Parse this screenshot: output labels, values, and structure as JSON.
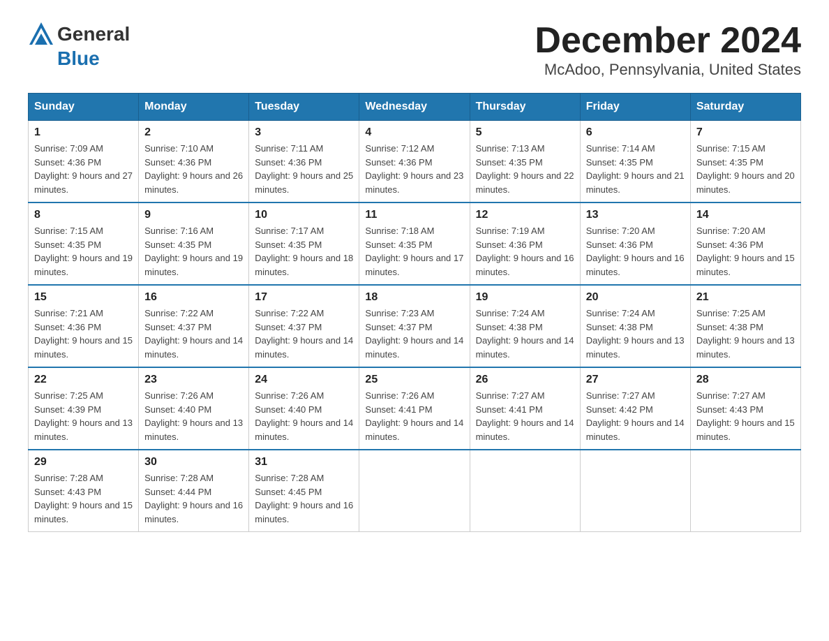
{
  "header": {
    "logo_general": "General",
    "logo_blue": "Blue",
    "title": "December 2024",
    "subtitle": "McAdoo, Pennsylvania, United States"
  },
  "calendar": {
    "days_of_week": [
      "Sunday",
      "Monday",
      "Tuesday",
      "Wednesday",
      "Thursday",
      "Friday",
      "Saturday"
    ],
    "weeks": [
      [
        {
          "day": "1",
          "sunrise": "7:09 AM",
          "sunset": "4:36 PM",
          "daylight": "9 hours and 27 minutes."
        },
        {
          "day": "2",
          "sunrise": "7:10 AM",
          "sunset": "4:36 PM",
          "daylight": "9 hours and 26 minutes."
        },
        {
          "day": "3",
          "sunrise": "7:11 AM",
          "sunset": "4:36 PM",
          "daylight": "9 hours and 25 minutes."
        },
        {
          "day": "4",
          "sunrise": "7:12 AM",
          "sunset": "4:36 PM",
          "daylight": "9 hours and 23 minutes."
        },
        {
          "day": "5",
          "sunrise": "7:13 AM",
          "sunset": "4:35 PM",
          "daylight": "9 hours and 22 minutes."
        },
        {
          "day": "6",
          "sunrise": "7:14 AM",
          "sunset": "4:35 PM",
          "daylight": "9 hours and 21 minutes."
        },
        {
          "day": "7",
          "sunrise": "7:15 AM",
          "sunset": "4:35 PM",
          "daylight": "9 hours and 20 minutes."
        }
      ],
      [
        {
          "day": "8",
          "sunrise": "7:15 AM",
          "sunset": "4:35 PM",
          "daylight": "9 hours and 19 minutes."
        },
        {
          "day": "9",
          "sunrise": "7:16 AM",
          "sunset": "4:35 PM",
          "daylight": "9 hours and 19 minutes."
        },
        {
          "day": "10",
          "sunrise": "7:17 AM",
          "sunset": "4:35 PM",
          "daylight": "9 hours and 18 minutes."
        },
        {
          "day": "11",
          "sunrise": "7:18 AM",
          "sunset": "4:35 PM",
          "daylight": "9 hours and 17 minutes."
        },
        {
          "day": "12",
          "sunrise": "7:19 AM",
          "sunset": "4:36 PM",
          "daylight": "9 hours and 16 minutes."
        },
        {
          "day": "13",
          "sunrise": "7:20 AM",
          "sunset": "4:36 PM",
          "daylight": "9 hours and 16 minutes."
        },
        {
          "day": "14",
          "sunrise": "7:20 AM",
          "sunset": "4:36 PM",
          "daylight": "9 hours and 15 minutes."
        }
      ],
      [
        {
          "day": "15",
          "sunrise": "7:21 AM",
          "sunset": "4:36 PM",
          "daylight": "9 hours and 15 minutes."
        },
        {
          "day": "16",
          "sunrise": "7:22 AM",
          "sunset": "4:37 PM",
          "daylight": "9 hours and 14 minutes."
        },
        {
          "day": "17",
          "sunrise": "7:22 AM",
          "sunset": "4:37 PM",
          "daylight": "9 hours and 14 minutes."
        },
        {
          "day": "18",
          "sunrise": "7:23 AM",
          "sunset": "4:37 PM",
          "daylight": "9 hours and 14 minutes."
        },
        {
          "day": "19",
          "sunrise": "7:24 AM",
          "sunset": "4:38 PM",
          "daylight": "9 hours and 14 minutes."
        },
        {
          "day": "20",
          "sunrise": "7:24 AM",
          "sunset": "4:38 PM",
          "daylight": "9 hours and 13 minutes."
        },
        {
          "day": "21",
          "sunrise": "7:25 AM",
          "sunset": "4:38 PM",
          "daylight": "9 hours and 13 minutes."
        }
      ],
      [
        {
          "day": "22",
          "sunrise": "7:25 AM",
          "sunset": "4:39 PM",
          "daylight": "9 hours and 13 minutes."
        },
        {
          "day": "23",
          "sunrise": "7:26 AM",
          "sunset": "4:40 PM",
          "daylight": "9 hours and 13 minutes."
        },
        {
          "day": "24",
          "sunrise": "7:26 AM",
          "sunset": "4:40 PM",
          "daylight": "9 hours and 14 minutes."
        },
        {
          "day": "25",
          "sunrise": "7:26 AM",
          "sunset": "4:41 PM",
          "daylight": "9 hours and 14 minutes."
        },
        {
          "day": "26",
          "sunrise": "7:27 AM",
          "sunset": "4:41 PM",
          "daylight": "9 hours and 14 minutes."
        },
        {
          "day": "27",
          "sunrise": "7:27 AM",
          "sunset": "4:42 PM",
          "daylight": "9 hours and 14 minutes."
        },
        {
          "day": "28",
          "sunrise": "7:27 AM",
          "sunset": "4:43 PM",
          "daylight": "9 hours and 15 minutes."
        }
      ],
      [
        {
          "day": "29",
          "sunrise": "7:28 AM",
          "sunset": "4:43 PM",
          "daylight": "9 hours and 15 minutes."
        },
        {
          "day": "30",
          "sunrise": "7:28 AM",
          "sunset": "4:44 PM",
          "daylight": "9 hours and 16 minutes."
        },
        {
          "day": "31",
          "sunrise": "7:28 AM",
          "sunset": "4:45 PM",
          "daylight": "9 hours and 16 minutes."
        },
        null,
        null,
        null,
        null
      ]
    ]
  }
}
